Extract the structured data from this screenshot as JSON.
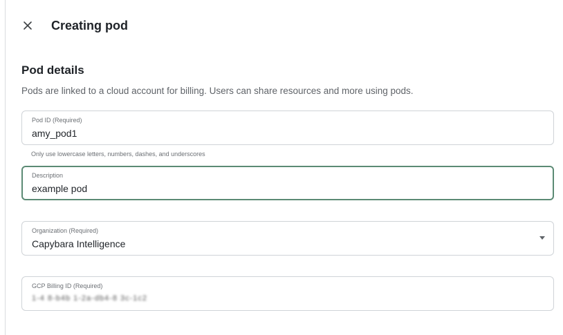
{
  "header": {
    "title": "Creating pod",
    "close_icon": "close-icon"
  },
  "section": {
    "title": "Pod details",
    "description": "Pods are linked to a cloud account for billing. Users can share resources and more using pods."
  },
  "fields": {
    "pod_id": {
      "label": "Pod ID (Required)",
      "value": "amy_pod1",
      "helper": "Only use lowercase letters, numbers, dashes, and underscores"
    },
    "description": {
      "label": "Description",
      "value": "example pod"
    },
    "organization": {
      "label": "Organization (Required)",
      "value": "Capybara Intelligence",
      "icon": "dropdown-caret-icon"
    },
    "billing": {
      "label": "GCP Billing ID (Required)",
      "value": "1-4 8-b4b 1-2a-db4-8 3c-1c2"
    }
  },
  "colors": {
    "focus_border": "#5b8a74",
    "border": "#cfd3d7",
    "muted_text": "#5f6368"
  }
}
